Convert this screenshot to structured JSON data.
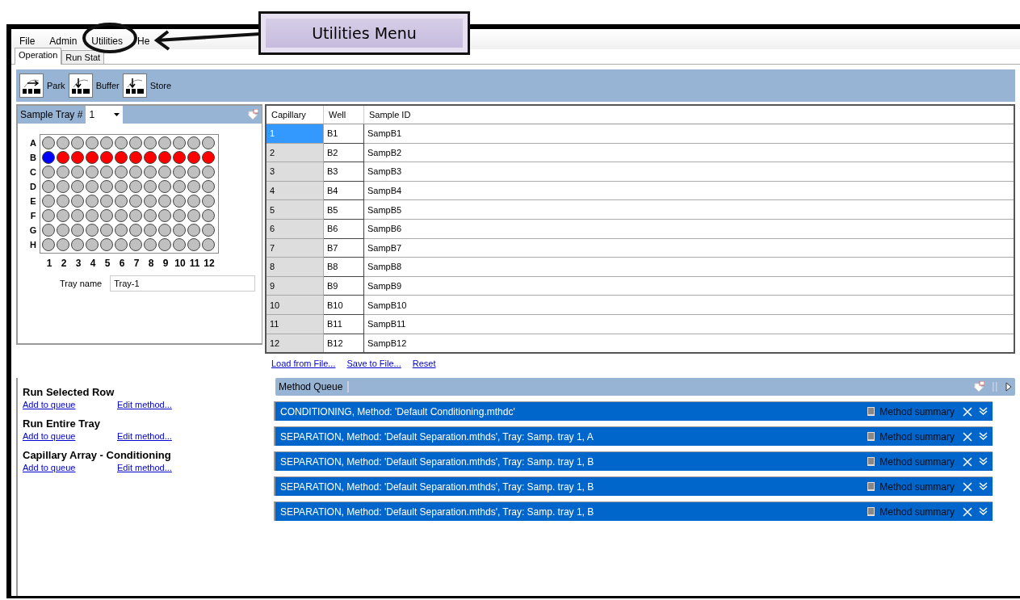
{
  "callout": {
    "text": "Utilities Menu"
  },
  "menu": [
    "File",
    "Admin",
    "Utilities",
    "He"
  ],
  "tabs": [
    {
      "label": "Operation",
      "selected": true
    },
    {
      "label": "Run Stat",
      "selected": false
    }
  ],
  "toolbar": [
    {
      "label": "Park",
      "kind": "park"
    },
    {
      "label": "Buffer",
      "kind": "buffer"
    },
    {
      "label": "Store",
      "kind": "store"
    }
  ],
  "tray": {
    "label": "Sample Tray #",
    "value": "1",
    "columns": [
      "1",
      "2",
      "3",
      "4",
      "5",
      "6",
      "7",
      "8",
      "9",
      "10",
      "11",
      "12"
    ],
    "rows": [
      {
        "label": "A",
        "wells": [
          {
            "color": "#c0c0c0"
          },
          {
            "color": "#c0c0c0"
          },
          {
            "color": "#c0c0c0"
          },
          {
            "color": "#c0c0c0"
          },
          {
            "color": "#c0c0c0"
          },
          {
            "color": "#c0c0c0"
          },
          {
            "color": "#c0c0c0"
          },
          {
            "color": "#c0c0c0"
          },
          {
            "color": "#c0c0c0"
          },
          {
            "color": "#c0c0c0"
          },
          {
            "color": "#c0c0c0"
          },
          {
            "color": "#c0c0c0"
          }
        ]
      },
      {
        "label": "B",
        "wells": [
          {
            "color": "#0000ff"
          },
          {
            "color": "#ff0000"
          },
          {
            "color": "#ff0000"
          },
          {
            "color": "#ff0000"
          },
          {
            "color": "#ff0000"
          },
          {
            "color": "#ff0000"
          },
          {
            "color": "#ff0000"
          },
          {
            "color": "#ff0000"
          },
          {
            "color": "#ff0000"
          },
          {
            "color": "#ff0000"
          },
          {
            "color": "#ff0000"
          },
          {
            "color": "#ff0000"
          }
        ]
      },
      {
        "label": "C",
        "wells": [
          {
            "color": "#c0c0c0"
          },
          {
            "color": "#c0c0c0"
          },
          {
            "color": "#c0c0c0"
          },
          {
            "color": "#c0c0c0"
          },
          {
            "color": "#c0c0c0"
          },
          {
            "color": "#c0c0c0"
          },
          {
            "color": "#c0c0c0"
          },
          {
            "color": "#c0c0c0"
          },
          {
            "color": "#c0c0c0"
          },
          {
            "color": "#c0c0c0"
          },
          {
            "color": "#c0c0c0"
          },
          {
            "color": "#c0c0c0"
          }
        ]
      },
      {
        "label": "D",
        "wells": [
          {
            "color": "#c0c0c0"
          },
          {
            "color": "#c0c0c0"
          },
          {
            "color": "#c0c0c0"
          },
          {
            "color": "#c0c0c0"
          },
          {
            "color": "#c0c0c0"
          },
          {
            "color": "#c0c0c0"
          },
          {
            "color": "#c0c0c0"
          },
          {
            "color": "#c0c0c0"
          },
          {
            "color": "#c0c0c0"
          },
          {
            "color": "#c0c0c0"
          },
          {
            "color": "#c0c0c0"
          },
          {
            "color": "#c0c0c0"
          }
        ]
      },
      {
        "label": "E",
        "wells": [
          {
            "color": "#c0c0c0"
          },
          {
            "color": "#c0c0c0"
          },
          {
            "color": "#c0c0c0"
          },
          {
            "color": "#c0c0c0"
          },
          {
            "color": "#c0c0c0"
          },
          {
            "color": "#c0c0c0"
          },
          {
            "color": "#c0c0c0"
          },
          {
            "color": "#c0c0c0"
          },
          {
            "color": "#c0c0c0"
          },
          {
            "color": "#c0c0c0"
          },
          {
            "color": "#c0c0c0"
          },
          {
            "color": "#c0c0c0"
          }
        ]
      },
      {
        "label": "F",
        "wells": [
          {
            "color": "#c0c0c0"
          },
          {
            "color": "#c0c0c0"
          },
          {
            "color": "#c0c0c0"
          },
          {
            "color": "#c0c0c0"
          },
          {
            "color": "#c0c0c0"
          },
          {
            "color": "#c0c0c0"
          },
          {
            "color": "#c0c0c0"
          },
          {
            "color": "#c0c0c0"
          },
          {
            "color": "#c0c0c0"
          },
          {
            "color": "#c0c0c0"
          },
          {
            "color": "#c0c0c0"
          },
          {
            "color": "#c0c0c0"
          }
        ]
      },
      {
        "label": "G",
        "wells": [
          {
            "color": "#c0c0c0"
          },
          {
            "color": "#c0c0c0"
          },
          {
            "color": "#c0c0c0"
          },
          {
            "color": "#c0c0c0"
          },
          {
            "color": "#c0c0c0"
          },
          {
            "color": "#c0c0c0"
          },
          {
            "color": "#c0c0c0"
          },
          {
            "color": "#c0c0c0"
          },
          {
            "color": "#c0c0c0"
          },
          {
            "color": "#c0c0c0"
          },
          {
            "color": "#c0c0c0"
          },
          {
            "color": "#c0c0c0"
          }
        ]
      },
      {
        "label": "H",
        "wells": [
          {
            "color": "#c0c0c0"
          },
          {
            "color": "#c0c0c0"
          },
          {
            "color": "#c0c0c0"
          },
          {
            "color": "#c0c0c0"
          },
          {
            "color": "#c0c0c0"
          },
          {
            "color": "#c0c0c0"
          },
          {
            "color": "#c0c0c0"
          },
          {
            "color": "#c0c0c0"
          },
          {
            "color": "#c0c0c0"
          },
          {
            "color": "#c0c0c0"
          },
          {
            "color": "#c0c0c0"
          },
          {
            "color": "#c0c0c0"
          }
        ]
      }
    ],
    "name_label": "Tray name",
    "name_value": "Tray-1"
  },
  "table": {
    "columns": [
      "Capillary",
      "Well",
      "Sample ID"
    ],
    "rows": [
      {
        "cells": [
          "1",
          "B1",
          "SampB1"
        ],
        "selected": true
      },
      {
        "cells": [
          "2",
          "B2",
          "SampB2"
        ],
        "selected": false
      },
      {
        "cells": [
          "3",
          "B3",
          "SampB3"
        ],
        "selected": false
      },
      {
        "cells": [
          "4",
          "B4",
          "SampB4"
        ],
        "selected": false
      },
      {
        "cells": [
          "5",
          "B5",
          "SampB5"
        ],
        "selected": false
      },
      {
        "cells": [
          "6",
          "B6",
          "SampB6"
        ],
        "selected": false
      },
      {
        "cells": [
          "7",
          "B7",
          "SampB7"
        ],
        "selected": false
      },
      {
        "cells": [
          "8",
          "B8",
          "SampB8"
        ],
        "selected": false
      },
      {
        "cells": [
          "9",
          "B9",
          "SampB9"
        ],
        "selected": false
      },
      {
        "cells": [
          "10",
          "B10",
          "SampB10"
        ],
        "selected": false
      },
      {
        "cells": [
          "11",
          "B11",
          "SampB11"
        ],
        "selected": false
      },
      {
        "cells": [
          "12",
          "B12",
          "SampB12"
        ],
        "selected": false
      }
    ],
    "links": [
      "Load from File...",
      "Save to File...",
      "Reset"
    ]
  },
  "run_sections": [
    {
      "title": "Run Selected Row",
      "add": "Add to queue",
      "edit": "Edit method..."
    },
    {
      "title": "Run Entire Tray",
      "add": "Add to queue",
      "edit": "Edit method..."
    },
    {
      "title": "Capillary Array - Conditioning",
      "add": "Add to queue",
      "edit": "Edit method..."
    }
  ],
  "queue": {
    "title": "Method Queue",
    "items": [
      {
        "text": "CONDITIONING, Method: 'Default Conditioning.mthdc'",
        "summary": "Method summary"
      },
      {
        "text": "SEPARATION, Method: 'Default Separation.mthds', Tray: Samp. tray 1, A",
        "summary": "Method summary"
      },
      {
        "text": "SEPARATION, Method: 'Default Separation.mthds', Tray: Samp. tray 1, B",
        "summary": "Method summary"
      },
      {
        "text": "SEPARATION, Method: 'Default Separation.mthds', Tray: Samp. tray 1, B",
        "summary": "Method summary"
      },
      {
        "text": "SEPARATION, Method: 'Default Separation.mthds', Tray: Samp. tray 1, B",
        "summary": "Method summary"
      }
    ]
  }
}
